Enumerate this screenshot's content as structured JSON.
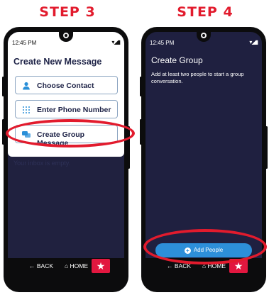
{
  "steps": {
    "left": "STEP 3",
    "right": "STEP 4"
  },
  "status_bar": {
    "time": "12:45 PM",
    "icons": "▾◢▮"
  },
  "step3": {
    "heading": "Create New Message",
    "options": [
      {
        "label": "Choose Contact",
        "icon": "person-icon"
      },
      {
        "label": "Enter Phone Number",
        "icon": "dialpad-icon"
      },
      {
        "label": "Create Group Message",
        "icon": "chat-bubbles-icon"
      }
    ],
    "inbox_text": "Your inbox is empty."
  },
  "step4": {
    "heading": "Create Group",
    "subtext": "Add at least two people to start a group conversation.",
    "add_button": "Add People"
  },
  "nav": {
    "back": "BACK",
    "home": "HOME"
  },
  "colors": {
    "accent_red": "#e21b2d",
    "navy": "#1f2040",
    "blue": "#2d8fd9"
  }
}
